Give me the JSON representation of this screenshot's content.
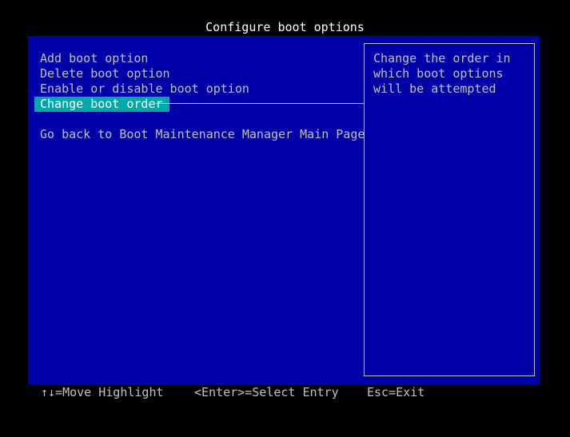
{
  "title": "Configure boot options",
  "menu": {
    "items": [
      {
        "label": "Add boot option"
      },
      {
        "label": "Delete boot option"
      },
      {
        "label": "Enable or disable boot option"
      },
      {
        "label": "Change boot order"
      },
      {
        "label": "Go back to Boot Maintenance Manager Main Page"
      }
    ],
    "selected_index": 3
  },
  "help": {
    "lines": [
      "Change the order in",
      "which boot options",
      "will be attempted"
    ]
  },
  "footer": {
    "move": "↑↓=Move Highlight",
    "select": "<Enter>=Select Entry",
    "exit": "Esc=Exit"
  },
  "colors": {
    "background": "#000000",
    "panel": "#0000a8",
    "highlight": "#00a8a8",
    "text": "#c0c0c0",
    "title_text": "#ffffff"
  }
}
